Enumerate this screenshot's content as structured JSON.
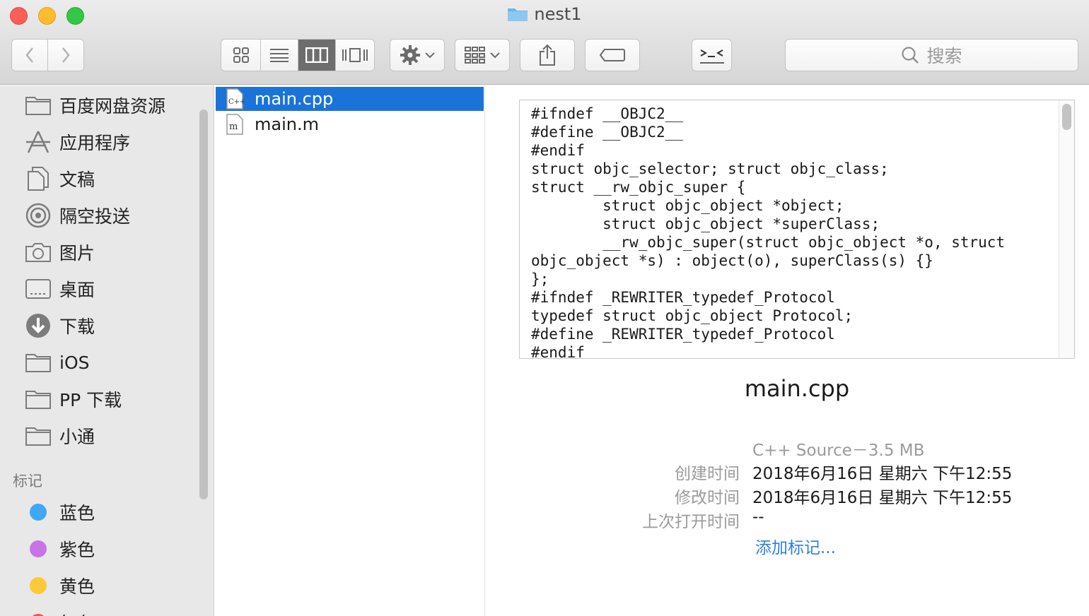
{
  "window": {
    "title": "nest1"
  },
  "toolbar": {
    "back": "back",
    "forward": "forward",
    "view_modes": [
      "icon-view",
      "list-view",
      "column-view",
      "gallery-view"
    ],
    "active_view": "column-view",
    "search_placeholder": "搜索"
  },
  "sidebar": {
    "favorites": [
      {
        "label": "百度网盘资源",
        "icon": "folder-icon"
      },
      {
        "label": "应用程序",
        "icon": "applications-icon"
      },
      {
        "label": "文稿",
        "icon": "documents-icon"
      },
      {
        "label": "隔空投送",
        "icon": "airdrop-icon"
      },
      {
        "label": "图片",
        "icon": "camera-icon"
      },
      {
        "label": "桌面",
        "icon": "desktop-icon"
      },
      {
        "label": "下载",
        "icon": "download-icon"
      },
      {
        "label": "iOS",
        "icon": "folder-icon"
      },
      {
        "label": "PP 下载",
        "icon": "folder-icon"
      },
      {
        "label": "小通",
        "icon": "folder-icon"
      }
    ],
    "tags_header": "标记",
    "tags": [
      {
        "label": "蓝色",
        "color": "#3fa8f4"
      },
      {
        "label": "紫色",
        "color": "#c874e6"
      },
      {
        "label": "黄色",
        "color": "#fcc938"
      },
      {
        "label": "红色",
        "color": "#f5544d"
      }
    ]
  },
  "files": [
    {
      "name": "main.cpp",
      "icon": "cpp-file-icon",
      "selected": true
    },
    {
      "name": "main.m",
      "icon": "objc-file-icon",
      "selected": false
    }
  ],
  "preview": {
    "code": "#ifndef __OBJC2__\n#define __OBJC2__\n#endif\nstruct objc_selector; struct objc_class;\nstruct __rw_objc_super {\n\tstruct objc_object *object;\n\tstruct objc_object *superClass;\n\t__rw_objc_super(struct objc_object *o, struct\nobjc_object *s) : object(o), superClass(s) {}\n};\n#ifndef _REWRITER_typedef_Protocol\ntypedef struct objc_object Protocol;\n#define _REWRITER_typedef_Protocol\n#endif",
    "file_name": "main.cpp",
    "kind": "C++ Source－3.5 MB",
    "created_label": "创建时间",
    "created_value": "2018年6月16日 星期六 下午12:55",
    "modified_label": "修改时间",
    "modified_value": "2018年6月16日 星期六 下午12:55",
    "last_opened_label": "上次打开时间",
    "last_opened_value": "--",
    "add_tags": "添加标记..."
  }
}
